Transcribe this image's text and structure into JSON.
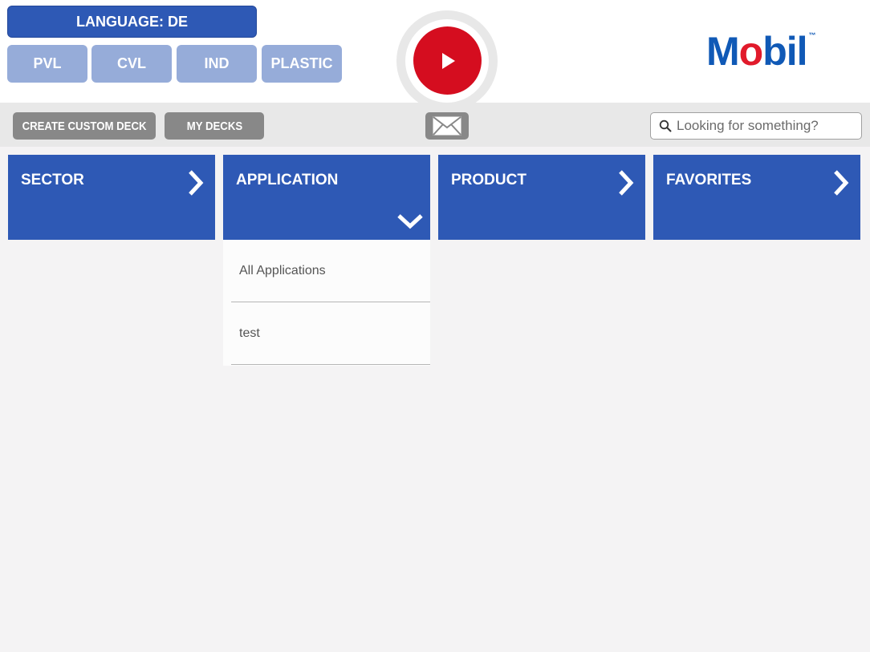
{
  "header": {
    "language_label": "LANGUAGE: DE",
    "segments": [
      "PVL",
      "CVL",
      "IND",
      "PLASTIC"
    ],
    "logo": {
      "text_before": "M",
      "text_o": "o",
      "text_after": "bil",
      "tm": "™",
      "color": "#1059b6",
      "accent": "#e11a2b"
    },
    "play_icon": "play-icon"
  },
  "toolbar": {
    "create_deck_label": "CREATE CUSTOM DECK",
    "my_decks_label": "MY DECKS",
    "mail_icon": "envelope-icon",
    "search_placeholder": "Looking for something?"
  },
  "tiles": [
    {
      "label": "SECTOR",
      "state": "collapsed"
    },
    {
      "label": "APPLICATION",
      "state": "expanded"
    },
    {
      "label": "PRODUCT",
      "state": "collapsed"
    },
    {
      "label": "FAVORITES",
      "state": "collapsed"
    }
  ],
  "application_dropdown": {
    "items": [
      "All Applications",
      "test"
    ]
  },
  "colors": {
    "brand_blue": "#2e59b5",
    "segment_blue": "#96acd9",
    "play_red": "#d50d1f",
    "tool_gray": "#888888"
  }
}
